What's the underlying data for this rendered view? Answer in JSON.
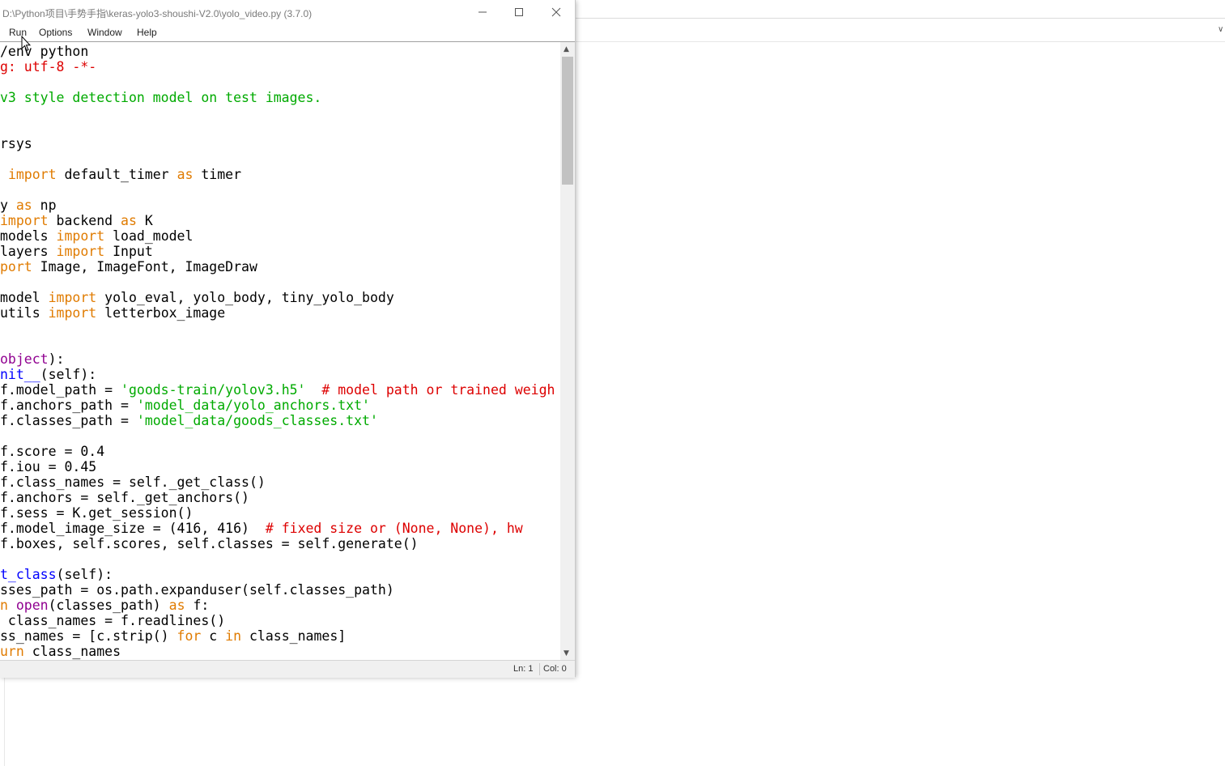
{
  "window": {
    "title": "D:\\Python项目\\手势手指\\keras-yolo3-shoushi-V2.0\\yolo_video.py (3.7.0)"
  },
  "menu": {
    "items": [
      "Run",
      "Options",
      "Window",
      "Help"
    ]
  },
  "editor": {
    "lines": [
      [
        {
          "t": "/env python"
        }
      ],
      [
        {
          "t": "g: utf-8 -*-",
          "c": "cm"
        }
      ],
      [],
      [
        {
          "t": "v3 style detection model on test images.",
          "c": "str"
        }
      ],
      [],
      [],
      [
        {
          "t": "rsys"
        }
      ],
      [],
      [
        {
          "t": " "
        },
        {
          "t": "import",
          "c": "kw"
        },
        {
          "t": " default_timer "
        },
        {
          "t": "as",
          "c": "kw"
        },
        {
          "t": " timer"
        }
      ],
      [],
      [
        {
          "t": "y "
        },
        {
          "t": "as",
          "c": "kw"
        },
        {
          "t": " np"
        }
      ],
      [
        {
          "t": "import",
          "c": "kw"
        },
        {
          "t": " backend "
        },
        {
          "t": "as",
          "c": "kw"
        },
        {
          "t": " K"
        }
      ],
      [
        {
          "t": "models "
        },
        {
          "t": "import",
          "c": "kw"
        },
        {
          "t": " load_model"
        }
      ],
      [
        {
          "t": "layers "
        },
        {
          "t": "import",
          "c": "kw"
        },
        {
          "t": " Input"
        }
      ],
      [
        {
          "t": "port",
          "c": "kw"
        },
        {
          "t": " Image, ImageFont, ImageDraw"
        }
      ],
      [],
      [
        {
          "t": "model "
        },
        {
          "t": "import",
          "c": "kw"
        },
        {
          "t": " yolo_eval, yolo_body, tiny_yolo_body"
        }
      ],
      [
        {
          "t": "utils "
        },
        {
          "t": "import",
          "c": "kw"
        },
        {
          "t": " letterbox_image"
        }
      ],
      [],
      [],
      [
        {
          "t": "object",
          "c": "bi"
        },
        {
          "t": "):"
        }
      ],
      [
        {
          "t": "nit__",
          "c": "df"
        },
        {
          "t": "(self):"
        }
      ],
      [
        {
          "t": "f.model_path = "
        },
        {
          "t": "'goods-train/yolov3.h5'",
          "c": "str"
        },
        {
          "t": "  "
        },
        {
          "t": "# model path or trained weigh",
          "c": "cm"
        }
      ],
      [
        {
          "t": "f.anchors_path = "
        },
        {
          "t": "'model_data/yolo_anchors.txt'",
          "c": "str"
        }
      ],
      [
        {
          "t": "f.classes_path = "
        },
        {
          "t": "'model_data/goods_classes.txt'",
          "c": "str"
        }
      ],
      [],
      [
        {
          "t": "f.score = 0.4"
        }
      ],
      [
        {
          "t": "f.iou = 0.45"
        }
      ],
      [
        {
          "t": "f.class_names = self._get_class()"
        }
      ],
      [
        {
          "t": "f.anchors = self._get_anchors()"
        }
      ],
      [
        {
          "t": "f.sess = K.get_session()"
        }
      ],
      [
        {
          "t": "f.model_image_size = (416, 416)  "
        },
        {
          "t": "# fixed size or (None, None), hw",
          "c": "cm"
        }
      ],
      [
        {
          "t": "f.boxes, self.scores, self.classes = self.generate()"
        }
      ],
      [],
      [
        {
          "t": "t_class",
          "c": "df"
        },
        {
          "t": "(self):"
        }
      ],
      [
        {
          "t": "sses_path = os.path.expanduser(self.classes_path)"
        }
      ],
      [
        {
          "t": "n ",
          "c": "kw"
        },
        {
          "t": "open",
          "c": "bi"
        },
        {
          "t": "(classes_path) "
        },
        {
          "t": "as",
          "c": "kw"
        },
        {
          "t": " f:"
        }
      ],
      [
        {
          "t": " class_names = f.readlines()"
        }
      ],
      [
        {
          "t": "ss_names = [c.strip() "
        },
        {
          "t": "for",
          "c": "kw"
        },
        {
          "t": " c "
        },
        {
          "t": "in",
          "c": "kw"
        },
        {
          "t": " class_names]"
        }
      ],
      [
        {
          "t": "urn",
          "c": "kw"
        },
        {
          "t": " class_names"
        }
      ]
    ]
  },
  "status": {
    "ln": "Ln: 1",
    "col": "Col: 0"
  },
  "icons": [
    "minimize-icon",
    "maximize-icon",
    "close-icon",
    "scroll-up-arrow-icon",
    "scroll-down-arrow-icon",
    "mouse-cursor-icon"
  ],
  "colors": {
    "keyword": "#e07b00",
    "string": "#00aa00",
    "comment": "#dd0000",
    "builtin": "#900090",
    "definition": "#0000ff"
  }
}
